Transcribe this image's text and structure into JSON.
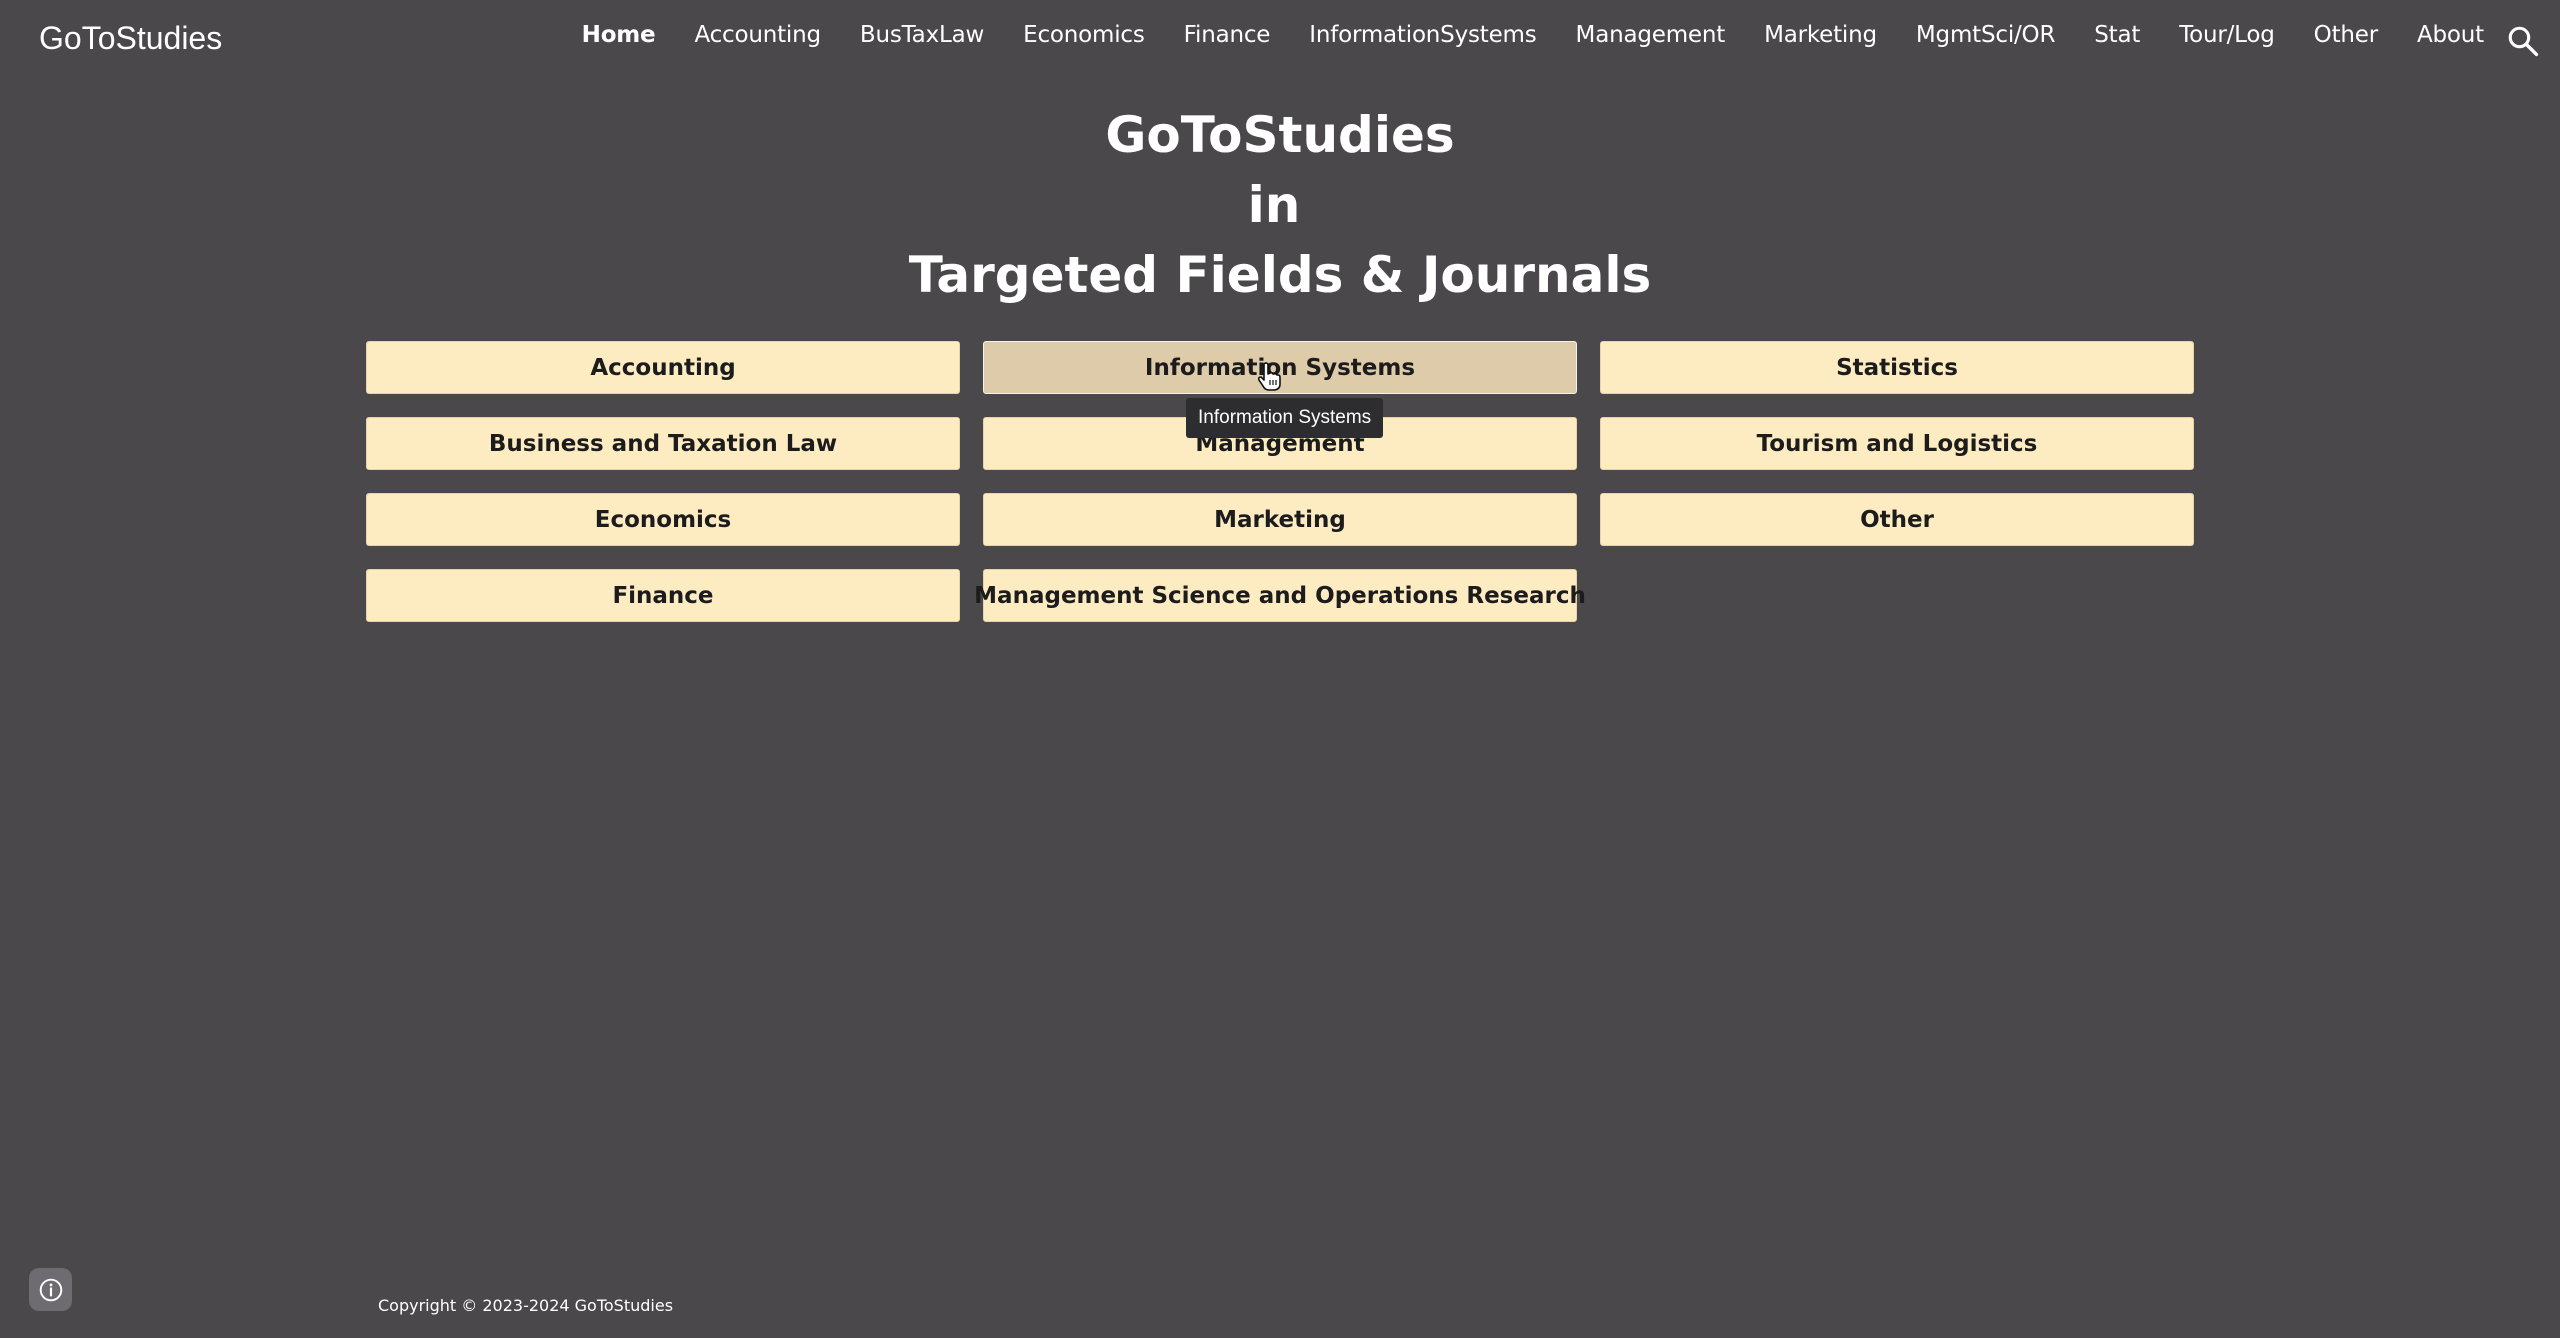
{
  "site": {
    "title": "GoToStudies"
  },
  "nav": {
    "items": [
      {
        "label": "Home",
        "active": true
      },
      {
        "label": "Accounting"
      },
      {
        "label": "BusTaxLaw"
      },
      {
        "label": "Economics"
      },
      {
        "label": "Finance"
      },
      {
        "label": "InformationSystems"
      },
      {
        "label": "Management"
      },
      {
        "label": "Marketing"
      },
      {
        "label": "MgmtSci/OR"
      },
      {
        "label": "Stat"
      },
      {
        "label": "Tour/Log"
      },
      {
        "label": "Other"
      },
      {
        "label": "About"
      }
    ],
    "search_icon": "search-icon"
  },
  "headline": {
    "line1": "GoToStudies",
    "line2": "in",
    "line3": "Targeted Fields & Journals"
  },
  "fields": {
    "col1": [
      "Accounting",
      "Business and Taxation Law",
      "Economics",
      "Finance"
    ],
    "col2": [
      "Information Systems",
      "Management",
      "Marketing",
      "Management Science and Operations Research"
    ],
    "col3": [
      "Statistics",
      "Tourism and Logistics",
      "Other"
    ]
  },
  "tooltip": {
    "text": "Information Systems"
  },
  "footer": {
    "copyright": "Copyright © 2023-2024 GoToStudies",
    "info_icon": "info-icon"
  },
  "colors": {
    "background": "#4a484b",
    "button_bg": "#fdebc2",
    "button_hover_bg": "#ddcbaa",
    "tooltip_bg": "#2d2d2f"
  }
}
